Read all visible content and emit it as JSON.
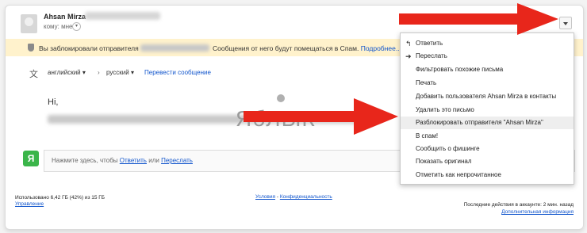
{
  "message": {
    "sender_name": "Ahsan Mirza",
    "to_line": "кому: мне",
    "greeting": "Hi,"
  },
  "banner": {
    "text_before": "Вы заблокировали отправителя",
    "text_after": "Сообщения от него будут помещаться в Спам.",
    "more_link": "Подробнее..."
  },
  "translate": {
    "from_lang": "английский",
    "to_lang": "русский",
    "arrow": "›",
    "link": "Перевести сообщение"
  },
  "watermark": "ЯбЛЫК",
  "reply": {
    "avatar_letter": "Я",
    "prompt": "Нажмите здесь, чтобы",
    "reply_link": "Ответить",
    "or": "или",
    "forward_link": "Переслать"
  },
  "footer": {
    "storage": "Использовано 6,42 ГБ (42%) из 15 ГБ",
    "manage": "Управление",
    "terms": "Условия",
    "sep": "-",
    "privacy": "Конфиденциальность",
    "activity": "Последние действия в аккаунте: 2 мин. назад",
    "details": "Дополнительная информация"
  },
  "menu": {
    "items": [
      {
        "label": "Ответить",
        "icon": "reply-icon"
      },
      {
        "label": "Переслать",
        "icon": "forward-icon"
      },
      {
        "label": "Фильтровать похожие письма"
      },
      {
        "label": "Печать"
      },
      {
        "label": "Добавить пользователя Ahsan Mirza в контакты"
      },
      {
        "label": "Удалить это письмо"
      },
      {
        "label": "Разблокировать отправителя \"Ahsan Mirza\""
      },
      {
        "label": "В спам!"
      },
      {
        "label": "Сообщить о фишинге"
      },
      {
        "label": "Показать оригинал"
      },
      {
        "label": "Отметить как непрочитанное"
      }
    ]
  },
  "colors": {
    "banner_bg": "#fff2cc",
    "link": "#1155cc",
    "arrow": "#e8261b",
    "avatar_green": "#3bb54a"
  }
}
